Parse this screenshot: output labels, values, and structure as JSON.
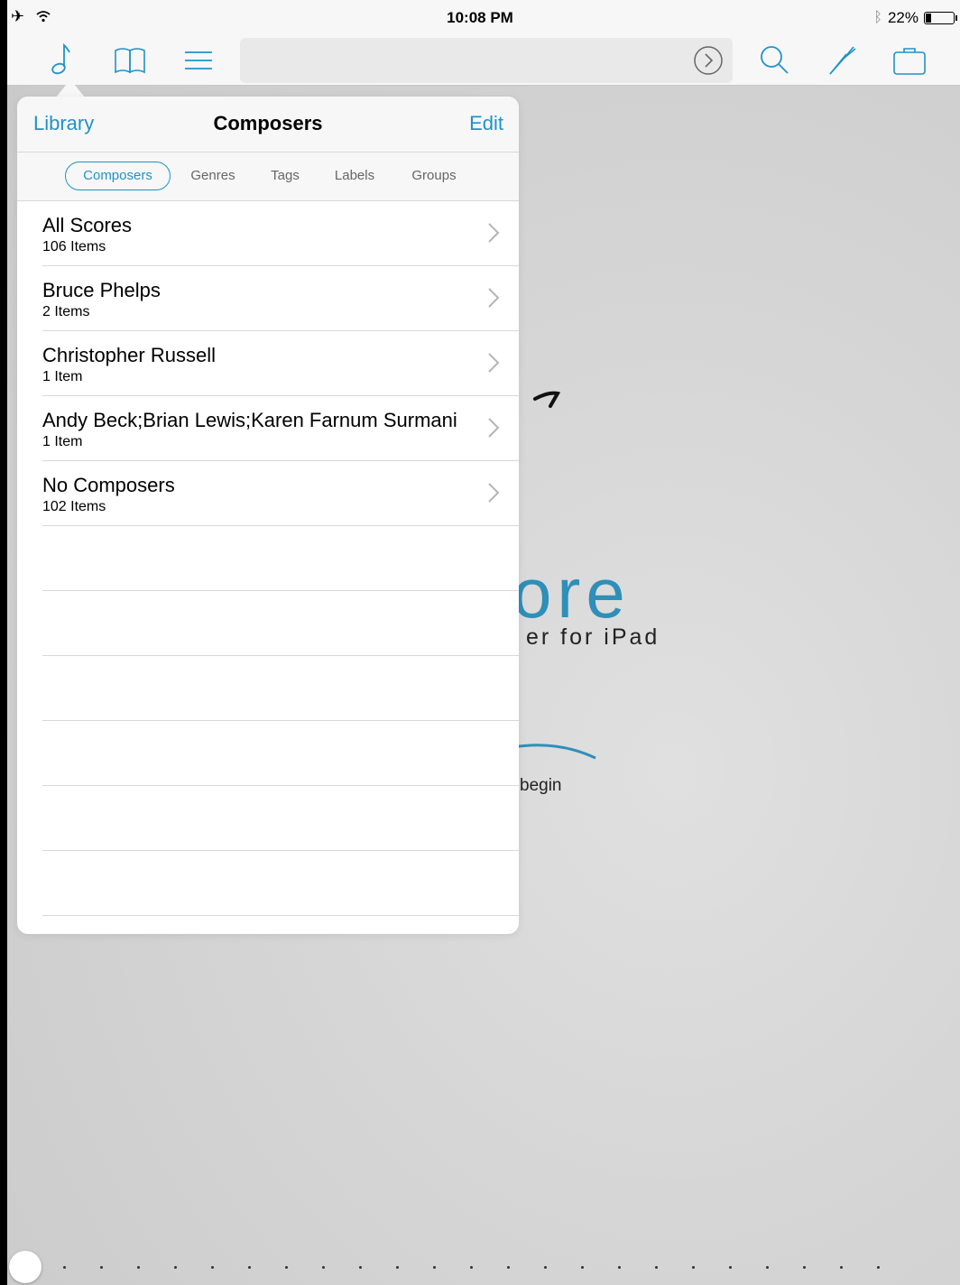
{
  "status": {
    "time": "10:08 PM",
    "battery": "22%",
    "battery_level": 0.22
  },
  "toolbar": {
    "icons": [
      "music-note-icon",
      "book-icon",
      "list-icon",
      "search-icon",
      "tuning-fork-icon",
      "briefcase-icon"
    ],
    "accent": "#1e93c9"
  },
  "splash": {
    "title_fragment": "ore",
    "subtitle_fragment": "er for iPad",
    "begin_fragment": "begin"
  },
  "popover": {
    "back_label": "Library",
    "title": "Composers",
    "edit_label": "Edit",
    "segments": [
      "Composers",
      "Genres",
      "Tags",
      "Labels",
      "Groups"
    ],
    "active_segment": "Composers",
    "rows": [
      {
        "title": "All Scores",
        "subtitle": "106 Items"
      },
      {
        "title": "Bruce Phelps",
        "subtitle": "2 Items"
      },
      {
        "title": "Christopher Russell",
        "subtitle": "1 Item"
      },
      {
        "title": "Andy Beck;Brian Lewis;Karen Farnum Surmani",
        "subtitle": "1 Item"
      },
      {
        "title": "No Composers",
        "subtitle": "102 Items"
      }
    ]
  }
}
